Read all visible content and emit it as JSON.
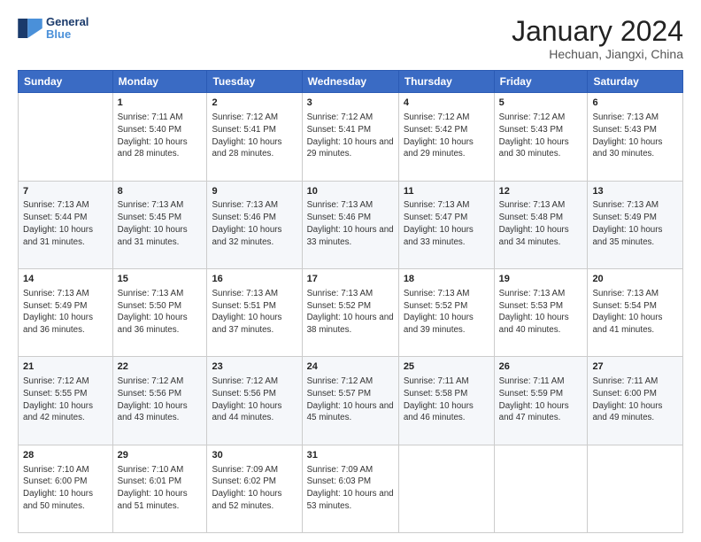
{
  "logo": {
    "text_general": "General",
    "text_blue": "Blue"
  },
  "header": {
    "month": "January 2024",
    "location": "Hechuan, Jiangxi, China"
  },
  "days_of_week": [
    "Sunday",
    "Monday",
    "Tuesday",
    "Wednesday",
    "Thursday",
    "Friday",
    "Saturday"
  ],
  "weeks": [
    [
      {
        "day": "",
        "sunrise": "",
        "sunset": "",
        "daylight": ""
      },
      {
        "day": "1",
        "sunrise": "Sunrise: 7:11 AM",
        "sunset": "Sunset: 5:40 PM",
        "daylight": "Daylight: 10 hours and 28 minutes."
      },
      {
        "day": "2",
        "sunrise": "Sunrise: 7:12 AM",
        "sunset": "Sunset: 5:41 PM",
        "daylight": "Daylight: 10 hours and 28 minutes."
      },
      {
        "day": "3",
        "sunrise": "Sunrise: 7:12 AM",
        "sunset": "Sunset: 5:41 PM",
        "daylight": "Daylight: 10 hours and 29 minutes."
      },
      {
        "day": "4",
        "sunrise": "Sunrise: 7:12 AM",
        "sunset": "Sunset: 5:42 PM",
        "daylight": "Daylight: 10 hours and 29 minutes."
      },
      {
        "day": "5",
        "sunrise": "Sunrise: 7:12 AM",
        "sunset": "Sunset: 5:43 PM",
        "daylight": "Daylight: 10 hours and 30 minutes."
      },
      {
        "day": "6",
        "sunrise": "Sunrise: 7:13 AM",
        "sunset": "Sunset: 5:43 PM",
        "daylight": "Daylight: 10 hours and 30 minutes."
      }
    ],
    [
      {
        "day": "7",
        "sunrise": "Sunrise: 7:13 AM",
        "sunset": "Sunset: 5:44 PM",
        "daylight": "Daylight: 10 hours and 31 minutes."
      },
      {
        "day": "8",
        "sunrise": "Sunrise: 7:13 AM",
        "sunset": "Sunset: 5:45 PM",
        "daylight": "Daylight: 10 hours and 31 minutes."
      },
      {
        "day": "9",
        "sunrise": "Sunrise: 7:13 AM",
        "sunset": "Sunset: 5:46 PM",
        "daylight": "Daylight: 10 hours and 32 minutes."
      },
      {
        "day": "10",
        "sunrise": "Sunrise: 7:13 AM",
        "sunset": "Sunset: 5:46 PM",
        "daylight": "Daylight: 10 hours and 33 minutes."
      },
      {
        "day": "11",
        "sunrise": "Sunrise: 7:13 AM",
        "sunset": "Sunset: 5:47 PM",
        "daylight": "Daylight: 10 hours and 33 minutes."
      },
      {
        "day": "12",
        "sunrise": "Sunrise: 7:13 AM",
        "sunset": "Sunset: 5:48 PM",
        "daylight": "Daylight: 10 hours and 34 minutes."
      },
      {
        "day": "13",
        "sunrise": "Sunrise: 7:13 AM",
        "sunset": "Sunset: 5:49 PM",
        "daylight": "Daylight: 10 hours and 35 minutes."
      }
    ],
    [
      {
        "day": "14",
        "sunrise": "Sunrise: 7:13 AM",
        "sunset": "Sunset: 5:49 PM",
        "daylight": "Daylight: 10 hours and 36 minutes."
      },
      {
        "day": "15",
        "sunrise": "Sunrise: 7:13 AM",
        "sunset": "Sunset: 5:50 PM",
        "daylight": "Daylight: 10 hours and 36 minutes."
      },
      {
        "day": "16",
        "sunrise": "Sunrise: 7:13 AM",
        "sunset": "Sunset: 5:51 PM",
        "daylight": "Daylight: 10 hours and 37 minutes."
      },
      {
        "day": "17",
        "sunrise": "Sunrise: 7:13 AM",
        "sunset": "Sunset: 5:52 PM",
        "daylight": "Daylight: 10 hours and 38 minutes."
      },
      {
        "day": "18",
        "sunrise": "Sunrise: 7:13 AM",
        "sunset": "Sunset: 5:52 PM",
        "daylight": "Daylight: 10 hours and 39 minutes."
      },
      {
        "day": "19",
        "sunrise": "Sunrise: 7:13 AM",
        "sunset": "Sunset: 5:53 PM",
        "daylight": "Daylight: 10 hours and 40 minutes."
      },
      {
        "day": "20",
        "sunrise": "Sunrise: 7:13 AM",
        "sunset": "Sunset: 5:54 PM",
        "daylight": "Daylight: 10 hours and 41 minutes."
      }
    ],
    [
      {
        "day": "21",
        "sunrise": "Sunrise: 7:12 AM",
        "sunset": "Sunset: 5:55 PM",
        "daylight": "Daylight: 10 hours and 42 minutes."
      },
      {
        "day": "22",
        "sunrise": "Sunrise: 7:12 AM",
        "sunset": "Sunset: 5:56 PM",
        "daylight": "Daylight: 10 hours and 43 minutes."
      },
      {
        "day": "23",
        "sunrise": "Sunrise: 7:12 AM",
        "sunset": "Sunset: 5:56 PM",
        "daylight": "Daylight: 10 hours and 44 minutes."
      },
      {
        "day": "24",
        "sunrise": "Sunrise: 7:12 AM",
        "sunset": "Sunset: 5:57 PM",
        "daylight": "Daylight: 10 hours and 45 minutes."
      },
      {
        "day": "25",
        "sunrise": "Sunrise: 7:11 AM",
        "sunset": "Sunset: 5:58 PM",
        "daylight": "Daylight: 10 hours and 46 minutes."
      },
      {
        "day": "26",
        "sunrise": "Sunrise: 7:11 AM",
        "sunset": "Sunset: 5:59 PM",
        "daylight": "Daylight: 10 hours and 47 minutes."
      },
      {
        "day": "27",
        "sunrise": "Sunrise: 7:11 AM",
        "sunset": "Sunset: 6:00 PM",
        "daylight": "Daylight: 10 hours and 49 minutes."
      }
    ],
    [
      {
        "day": "28",
        "sunrise": "Sunrise: 7:10 AM",
        "sunset": "Sunset: 6:00 PM",
        "daylight": "Daylight: 10 hours and 50 minutes."
      },
      {
        "day": "29",
        "sunrise": "Sunrise: 7:10 AM",
        "sunset": "Sunset: 6:01 PM",
        "daylight": "Daylight: 10 hours and 51 minutes."
      },
      {
        "day": "30",
        "sunrise": "Sunrise: 7:09 AM",
        "sunset": "Sunset: 6:02 PM",
        "daylight": "Daylight: 10 hours and 52 minutes."
      },
      {
        "day": "31",
        "sunrise": "Sunrise: 7:09 AM",
        "sunset": "Sunset: 6:03 PM",
        "daylight": "Daylight: 10 hours and 53 minutes."
      },
      {
        "day": "",
        "sunrise": "",
        "sunset": "",
        "daylight": ""
      },
      {
        "day": "",
        "sunrise": "",
        "sunset": "",
        "daylight": ""
      },
      {
        "day": "",
        "sunrise": "",
        "sunset": "",
        "daylight": ""
      }
    ]
  ]
}
